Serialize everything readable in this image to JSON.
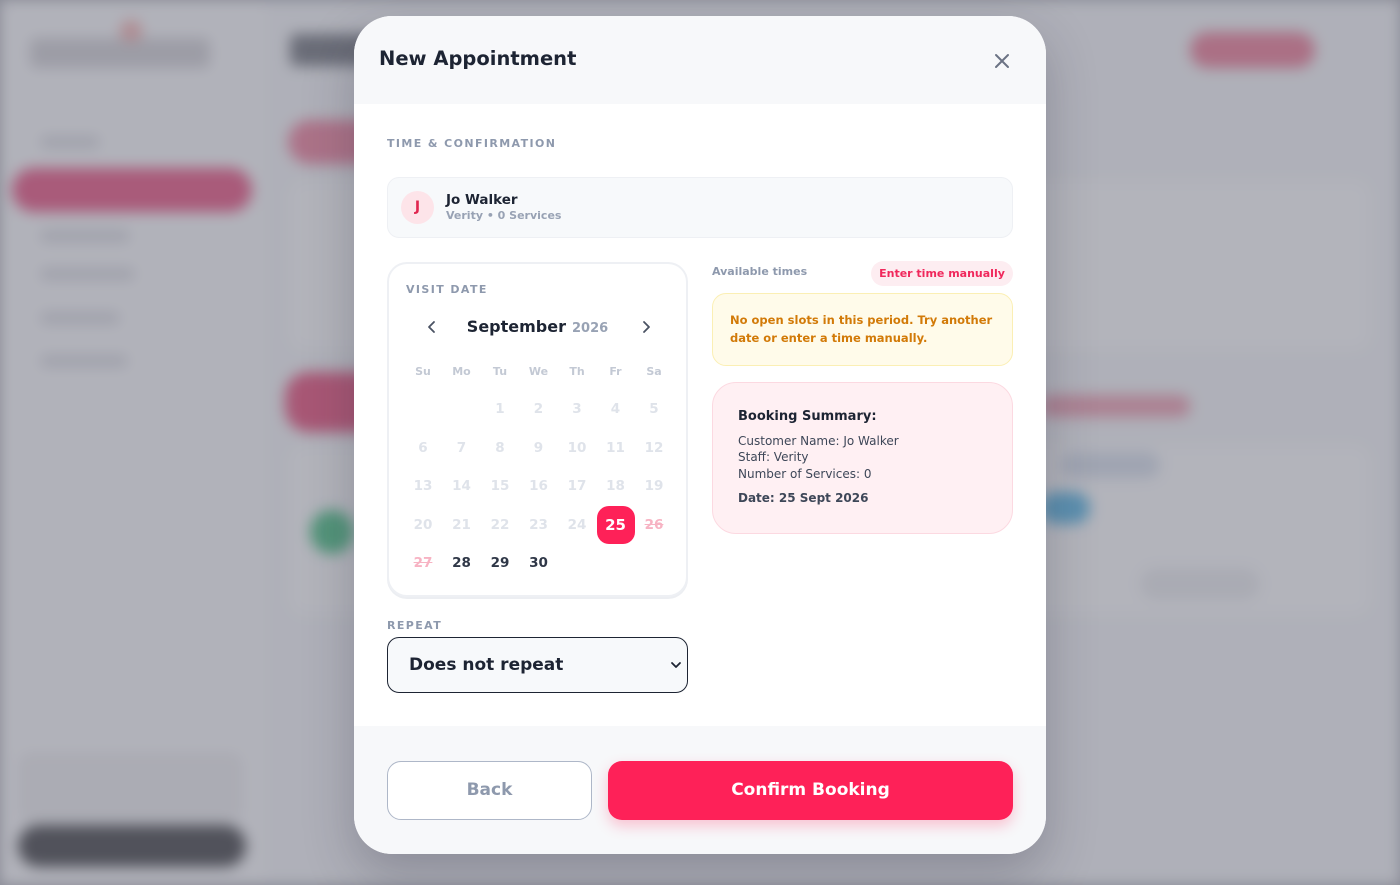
{
  "modal": {
    "title": "New Appointment",
    "section_label": "TIME & CONFIRMATION"
  },
  "customer": {
    "initial": "J",
    "name": "Jo Walker",
    "subtitle": "Verity • 0 Services"
  },
  "calendar": {
    "label": "VISIT DATE",
    "month": "September",
    "year": "2026",
    "weekdays": [
      "Su",
      "Mo",
      "Tu",
      "We",
      "Th",
      "Fr",
      "Sa"
    ],
    "first_weekday_index": 2,
    "days_in_month": 30,
    "selected_day": 25,
    "available_days": [
      28,
      29,
      30
    ],
    "blocked_days": [
      26,
      27
    ]
  },
  "repeat": {
    "label": "REPEAT",
    "value": "Does not repeat"
  },
  "times": {
    "label": "Available times",
    "manual_button": "Enter time manually",
    "notice": "No open slots in this period. Try another date or enter a time manually."
  },
  "summary": {
    "title": "Booking Summary:",
    "customer_line": "Customer Name: Jo Walker",
    "staff_line": "Staff: Verity",
    "services_line": "Number of Services: 0",
    "date_line": "Date: 25 Sept 2026"
  },
  "footer": {
    "back_label": "Back",
    "confirm_label": "Confirm Booking"
  },
  "colors": {
    "accent": "#fe2158",
    "notice_text": "#d27a08",
    "notice_bg": "#fffbea",
    "summary_bg": "#fff0f3"
  }
}
